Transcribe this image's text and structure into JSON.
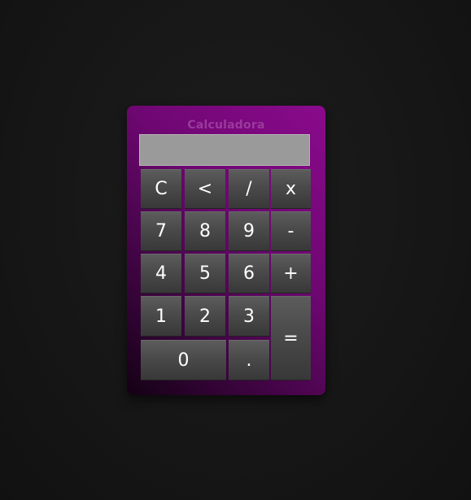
{
  "app": {
    "title": "Calculadora"
  },
  "display": {
    "value": ""
  },
  "keys": {
    "clear": "C",
    "backspace": "<",
    "divide": "/",
    "multiply": "x",
    "seven": "7",
    "eight": "8",
    "nine": "9",
    "subtract": "-",
    "four": "4",
    "five": "5",
    "six": "6",
    "add": "+",
    "one": "1",
    "two": "2",
    "three": "3",
    "equals": "=",
    "zero": "0",
    "decimal": "."
  },
  "colors": {
    "accent": "#8a0a8c",
    "title": "#9a3a9c",
    "key": "#4a4a4a",
    "display": "#9a9a9a"
  }
}
